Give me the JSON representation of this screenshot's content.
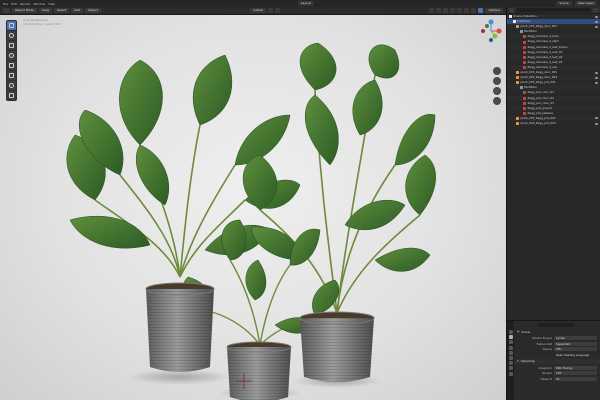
{
  "topbar": {
    "menus": [
      "File",
      "Edit",
      "Render",
      "Window",
      "Help"
    ],
    "workspace": "Layout",
    "scene": "Scene",
    "view_layer": "View Layer"
  },
  "viewport_header": {
    "mode": "Object Mode",
    "menus": [
      "View",
      "Select",
      "Add",
      "Object"
    ],
    "orientation": "Global",
    "options": "Options",
    "overlay_text": [
      "User Perspective",
      "(1) Collection | plant_003"
    ]
  },
  "outliner": {
    "rows": [
      {
        "label": "Scene Collection",
        "icon": "collection",
        "depth": 0,
        "selected": false
      },
      {
        "label": "Collection",
        "icon": "collection",
        "depth": 1,
        "selected": true
      },
      {
        "label": "plant_003_Zagg_Aloc_001",
        "icon": "object",
        "depth": 2,
        "selected": false
      },
      {
        "label": "Modifiers",
        "icon": "mod",
        "depth": 3,
        "selected": false
      },
      {
        "label": "Zagg_Alocasia_4_bark",
        "icon": "mesh",
        "depth": 4,
        "selected": false
      },
      {
        "label": "Zagg_Alocasia_4_stem",
        "icon": "mesh",
        "depth": 4,
        "selected": false
      },
      {
        "label": "Zagg_Alocasia_4_leaf_brown",
        "icon": "mesh",
        "depth": 4,
        "selected": false
      },
      {
        "label": "Zagg_Alocasia_4_leaf_01",
        "icon": "mesh",
        "depth": 4,
        "selected": false
      },
      {
        "label": "Zagg_Alocasia_4_leaf_02",
        "icon": "mesh",
        "depth": 4,
        "selected": false
      },
      {
        "label": "Zagg_Alocasia_4_leaf_03",
        "icon": "mesh",
        "depth": 4,
        "selected": false
      },
      {
        "label": "Zagg_Alocasia_4_soil",
        "icon": "mesh",
        "depth": 4,
        "selected": false
      },
      {
        "label": "plant_003_Zagg_Aloc_002",
        "icon": "object",
        "depth": 2,
        "selected": false
      },
      {
        "label": "plant_003_Zagg_Aloc_003",
        "icon": "object",
        "depth": 2,
        "selected": false
      },
      {
        "label": "plant_003_Zagg_pot_001",
        "icon": "object",
        "depth": 2,
        "selected": false
      },
      {
        "label": "Modifiers",
        "icon": "mod",
        "depth": 3,
        "selected": false
      },
      {
        "label": "Zagg_pot_color_01",
        "icon": "mesh",
        "depth": 4,
        "selected": false
      },
      {
        "label": "Zagg_pot_color_02",
        "icon": "mesh",
        "depth": 4,
        "selected": false
      },
      {
        "label": "Zagg_pot_color_03",
        "icon": "mesh",
        "depth": 4,
        "selected": false
      },
      {
        "label": "Zagg_pot_ground",
        "icon": "mesh",
        "depth": 4,
        "selected": false
      },
      {
        "label": "Zagg_pot_pebbles",
        "icon": "mesh",
        "depth": 4,
        "selected": false
      },
      {
        "label": "plant_003_Zagg_pot_002",
        "icon": "object",
        "depth": 2,
        "selected": false
      },
      {
        "label": "plant_003_Zagg_pot_003",
        "icon": "object",
        "depth": 2,
        "selected": false
      }
    ]
  },
  "properties": {
    "scene_label": "Scene",
    "rows": [
      {
        "label": "Render Engine",
        "value": "Cycles"
      },
      {
        "label": "Feature Set",
        "value": "Supported"
      },
      {
        "label": "Device",
        "value": "CPU"
      },
      {
        "label": "",
        "value": "Open Shading Language",
        "plain": true
      }
    ],
    "section": "Sampling",
    "sub_rows": [
      {
        "label": "Integrator",
        "value": "Path Tracing"
      },
      {
        "label": "Render",
        "value": "128"
      },
      {
        "label": "Viewport",
        "value": "32"
      }
    ]
  },
  "colors": {
    "accent": "#4772b3",
    "gizmo_x": "#e0424f",
    "gizmo_y": "#7fc241",
    "gizmo_z": "#3f8ef0"
  }
}
